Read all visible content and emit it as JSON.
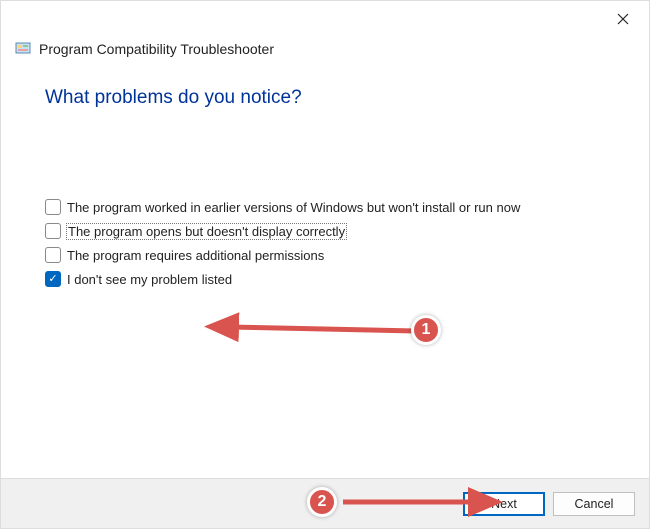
{
  "window": {
    "title": "Program Compatibility Troubleshooter"
  },
  "heading": "What problems do you notice?",
  "options": [
    {
      "label": "The program worked in earlier versions of Windows but won't install or run now",
      "checked": false,
      "focused": false
    },
    {
      "label": "The program opens but doesn't display correctly",
      "checked": false,
      "focused": true
    },
    {
      "label": "The program requires additional permissions",
      "checked": false,
      "focused": false
    },
    {
      "label": "I don't see my problem listed",
      "checked": true,
      "focused": false
    }
  ],
  "buttons": {
    "next": "Next",
    "cancel": "Cancel"
  },
  "annotations": {
    "badge1": "1",
    "badge2": "2"
  }
}
